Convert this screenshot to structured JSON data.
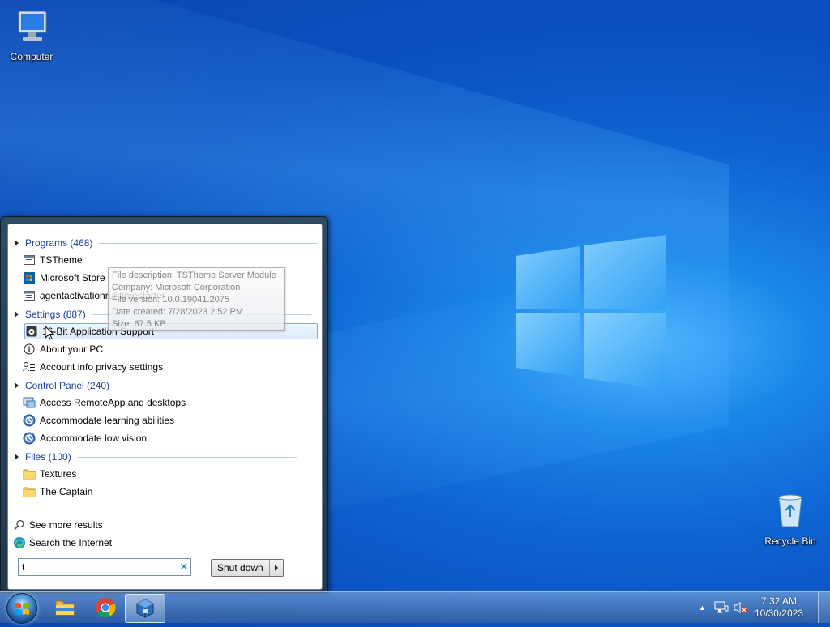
{
  "desktop": {
    "icons": [
      {
        "label": "Computer",
        "icon": "computer-icon"
      },
      {
        "label": "Recycle Bin",
        "icon": "recycle-bin-icon"
      }
    ]
  },
  "start_menu": {
    "sections": [
      {
        "header": "Programs (468)"
      },
      {
        "header": "Settings (887)"
      },
      {
        "header": "Control Panel (240)"
      },
      {
        "header": "Files (100)"
      }
    ],
    "programs": [
      "TSTheme",
      "Microsoft Store",
      "agentactivationruntimestarter"
    ],
    "settings": [
      "16-Bit Application Support",
      "About your PC",
      "Account info privacy settings"
    ],
    "control_panel": [
      "Access RemoteApp and desktops",
      "Accommodate learning abilities",
      "Accommodate low vision"
    ],
    "files": [
      "Textures",
      "The Captain"
    ],
    "see_more": "See more results",
    "search_internet": "Search the Internet",
    "search_value": "t",
    "shutdown_label": "Shut down"
  },
  "tooltip": {
    "lines": [
      "File description: TSTheme Server Module",
      "Company: Microsoft Corporation",
      "File version: 10.0.19041.2075",
      "Date created: 7/28/2023 2:52 PM",
      "Size: 67.5 KB"
    ]
  },
  "taskbar": {
    "pinned": [
      "file-explorer-icon",
      "chrome-icon",
      "virtualbox-icon"
    ],
    "time": "7:32 AM",
    "date": "10/30/2023"
  },
  "colors": {
    "section_header": "#1e3f97",
    "desktop_blue": "#0f64d2"
  }
}
